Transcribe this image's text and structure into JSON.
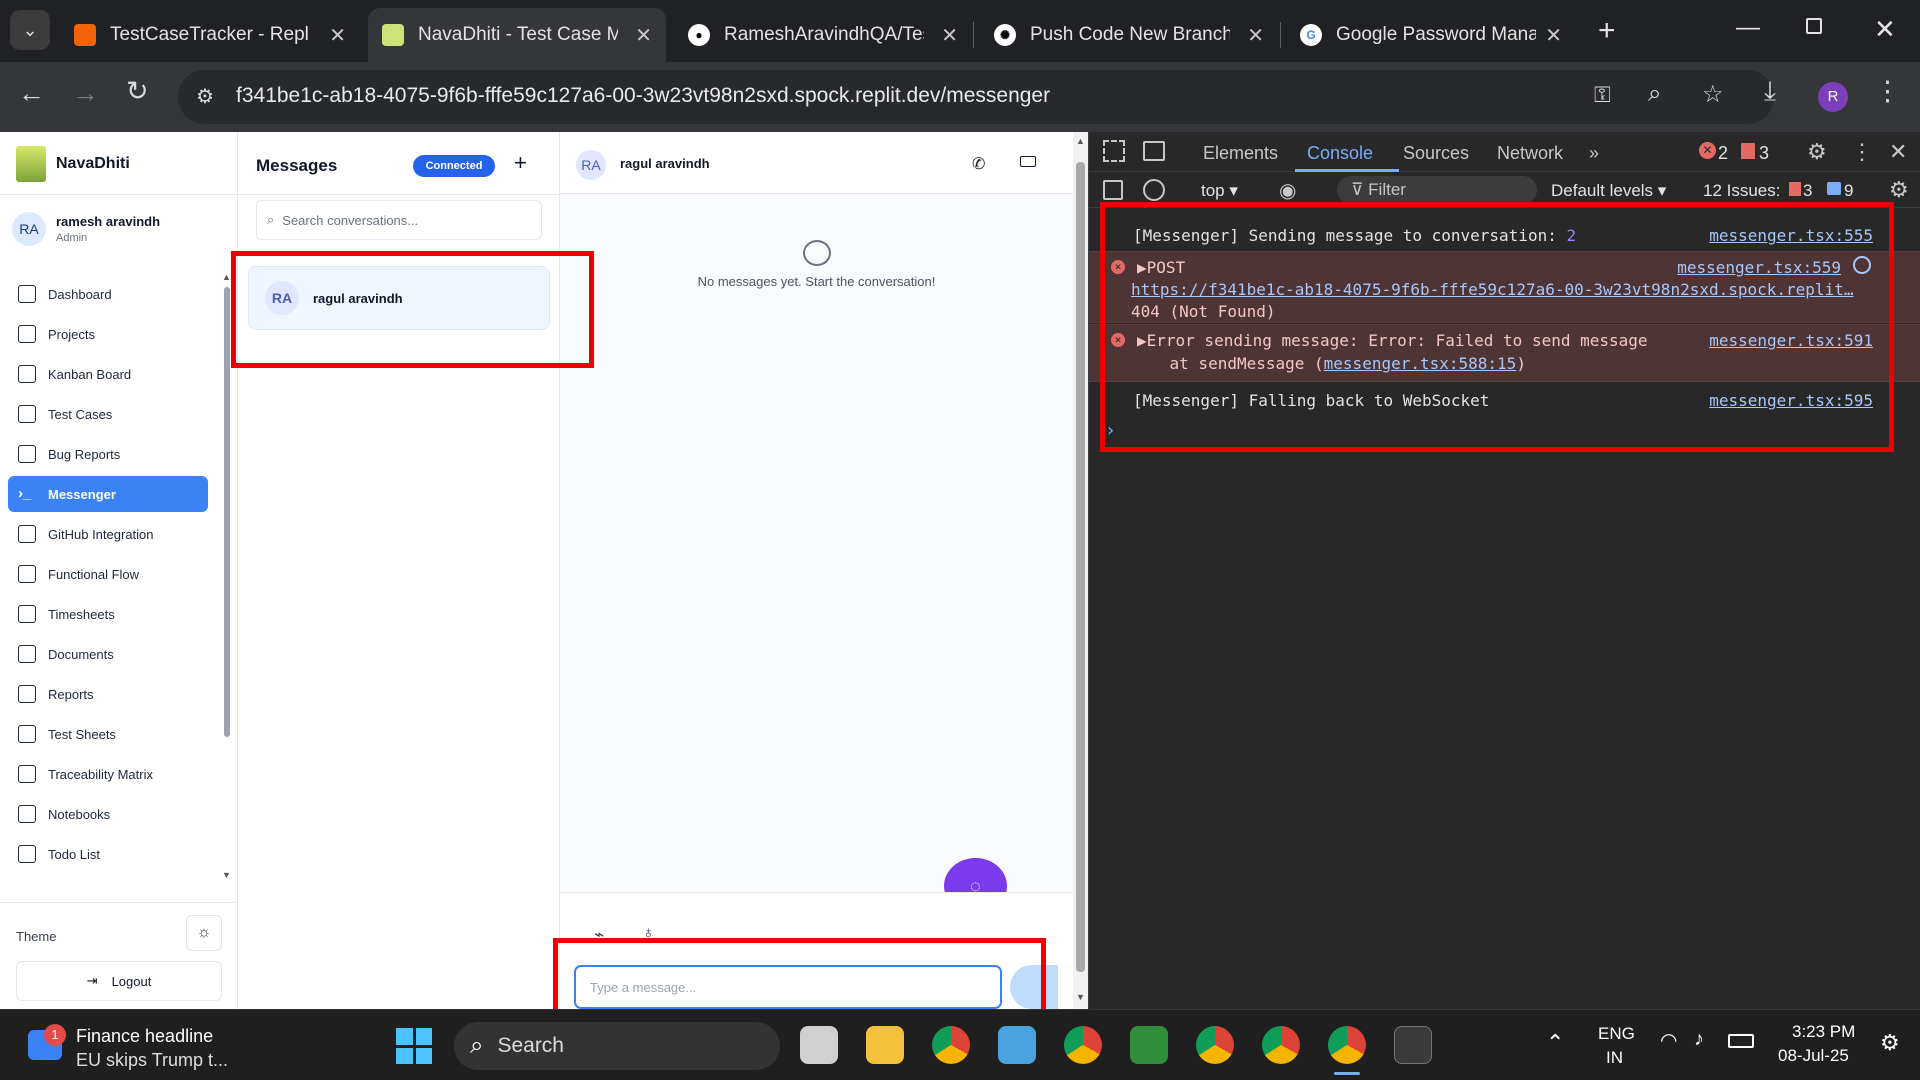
{
  "browser": {
    "tabs": [
      {
        "title": "TestCaseTracker - Replit",
        "icon": "replit-icon"
      },
      {
        "title": "NavaDhiti - Test Case Ma",
        "icon": "navadhiti-icon",
        "active": true
      },
      {
        "title": "RameshAravindhQA/Test",
        "icon": "github-icon"
      },
      {
        "title": "Push Code New Branch",
        "icon": "chatgpt-icon"
      },
      {
        "title": "Google Password Manag",
        "icon": "google-icon"
      }
    ],
    "new_tab": "+",
    "url": "f341be1c-ab18-4075-9f6b-fffe59c127a6-00-3w23vt98n2sxd.spock.replit.dev/messenger",
    "profile_initial": "R"
  },
  "sidebar": {
    "brand": "NavaDhiti",
    "user_initials": "RA",
    "user_name": "ramesh aravindh",
    "user_role": "Admin",
    "items": [
      "Dashboard",
      "Projects",
      "Kanban Board",
      "Test Cases",
      "Bug Reports",
      "Messenger",
      "GitHub Integration",
      "Functional Flow",
      "Timesheets",
      "Documents",
      "Reports",
      "Test Sheets",
      "Traceability Matrix",
      "Notebooks",
      "Todo List"
    ],
    "selected": "Messenger",
    "theme_label": "Theme",
    "logout_label": "Logout"
  },
  "conversations": {
    "title": "Messages",
    "status_badge": "Connected",
    "search_placeholder": "Search conversations...",
    "items": [
      {
        "initials": "RA",
        "name": "ragul aravindh"
      }
    ]
  },
  "chat": {
    "contact_initials": "RA",
    "contact_name": "ragul aravindh",
    "empty_text": "No messages yet. Start the conversation!",
    "input_placeholder": "Type a message..."
  },
  "devtools": {
    "tabs": [
      "Elements",
      "Console",
      "Sources",
      "Network"
    ],
    "active_tab": "Console",
    "error_count": "2",
    "warning_count": "3",
    "context": "top",
    "filter_placeholder": "Filter",
    "levels": "Default levels",
    "issues_label": "12 Issues:",
    "issues_warn": "3",
    "issues_info": "9",
    "logs": [
      {
        "type": "log",
        "text": "[Messenger] Sending message to conversation: ",
        "value": "2",
        "source": "messenger.tsx:555"
      },
      {
        "type": "error",
        "text": "▶POST",
        "source": "messenger.tsx:559",
        "link": "https://f341be1c-ab18-4075-9f6b-fffe59c127a6-00-3w23vt98n2sxd.spock.replit…",
        "extra": "404 (Not Found)"
      },
      {
        "type": "error",
        "text": "▶Error sending message: Error: Failed to send message",
        "source": "messenger.tsx:591",
        "extra_prefix": "    at sendMessage (",
        "extra_link": "messenger.tsx:588:15",
        "extra_suffix": ")"
      },
      {
        "type": "log",
        "text": "[Messenger] Falling back to WebSocket",
        "source": "messenger.tsx:595"
      }
    ],
    "prompt": "›"
  },
  "taskbar": {
    "news_badge": "1",
    "news_title": "Finance headline",
    "news_sub": "EU skips Trump t...",
    "search_label": "Search",
    "lang_top": "ENG",
    "lang_bottom": "IN",
    "time": "3:23 PM",
    "date": "08-Jul-25"
  },
  "colors": {
    "accent": "#3b82f6",
    "highlight": "#ee0000",
    "fab": "#7c3aed"
  }
}
